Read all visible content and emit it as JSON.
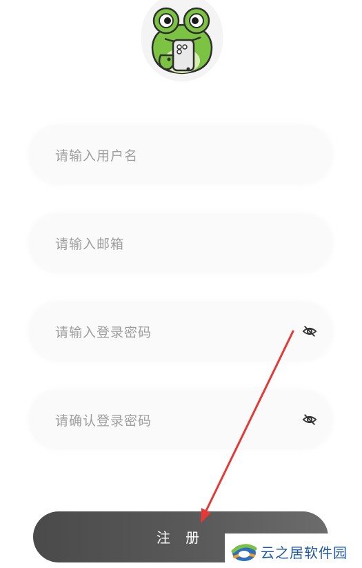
{
  "form": {
    "username_placeholder": "请输入用户名",
    "email_placeholder": "请输入邮箱",
    "password_placeholder": "请输入登录密码",
    "confirm_placeholder": "请确认登录密码"
  },
  "register_button": {
    "label": "注 册"
  },
  "watermark": {
    "text": "云之居软件园"
  },
  "icons": {
    "avatar": "frog-mascot-icon",
    "password_toggle": "eye-off-icon",
    "confirm_toggle": "eye-off-icon"
  },
  "colors": {
    "button": "#555555",
    "placeholder": "#9e9e9e",
    "field_bg": "#fafafa",
    "annotation": "#e53935",
    "watermark": "#1f5aa8"
  }
}
